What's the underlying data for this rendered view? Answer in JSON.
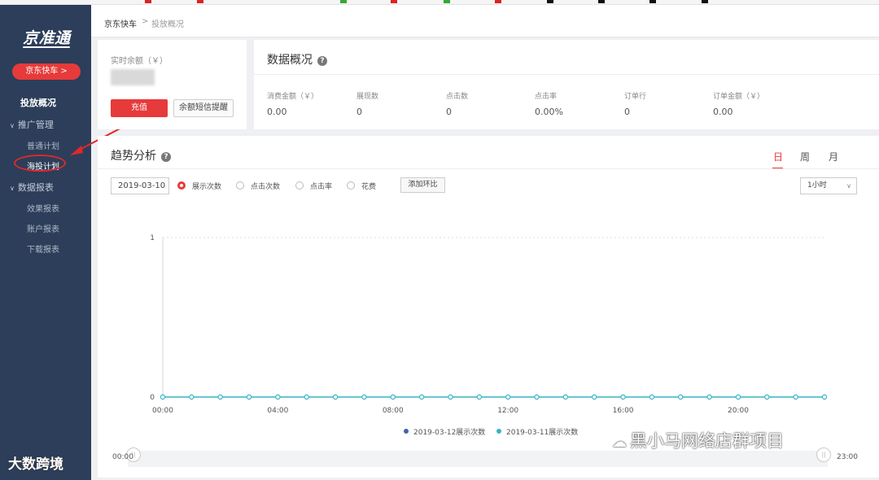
{
  "sidebar": {
    "logo": "京准通",
    "product_button": "京东快车 >",
    "nav": {
      "overview": "投放概况",
      "promo_group": "推广管理",
      "normal_plan": "普通计划",
      "mass_plan": "海投计划",
      "report_group": "数据报表",
      "effect_report": "效果报表",
      "account_report": "账户报表",
      "download_report": "下载报表"
    }
  },
  "breadcrumb": {
    "root": "京东快车",
    "sep": ">",
    "current": "投放概况"
  },
  "balance": {
    "label": "实时余额（￥）",
    "recharge_button": "充值",
    "sms_button": "余额短信提醒"
  },
  "overview": {
    "title": "数据概况",
    "metrics": [
      {
        "label": "消费金额（￥）",
        "value": "0.00"
      },
      {
        "label": "展现数",
        "value": "0"
      },
      {
        "label": "点击数",
        "value": "0"
      },
      {
        "label": "点击率",
        "value": "0.00%"
      },
      {
        "label": "订单行",
        "value": "0"
      },
      {
        "label": "订单金额（￥）",
        "value": "0.00"
      }
    ]
  },
  "trend": {
    "title": "趋势分析",
    "periods": [
      "日",
      "周",
      "月"
    ],
    "active_period": "日",
    "date": "2019-03-10",
    "metrics": [
      "展示次数",
      "点击次数",
      "点击率",
      "花费"
    ],
    "selected_metric": "展示次数",
    "compare_button": "添加环比",
    "interval": "1小时",
    "slider": {
      "start": "00:00",
      "end": "23:00"
    }
  },
  "chart_data": {
    "type": "line",
    "x": [
      "00:00",
      "01:00",
      "02:00",
      "03:00",
      "04:00",
      "05:00",
      "06:00",
      "07:00",
      "08:00",
      "09:00",
      "10:00",
      "11:00",
      "12:00",
      "13:00",
      "14:00",
      "15:00",
      "16:00",
      "17:00",
      "18:00",
      "19:00",
      "20:00",
      "21:00",
      "22:00",
      "23:00"
    ],
    "x_tick_labels": [
      "00:00",
      "04:00",
      "08:00",
      "12:00",
      "16:00",
      "20:00"
    ],
    "y_tick_labels": [
      "0",
      "1"
    ],
    "ylim": [
      0,
      1
    ],
    "series": [
      {
        "name": "2019-03-12展示次数",
        "color": "#3f64a8",
        "values": []
      },
      {
        "name": "2019-03-11展示次数",
        "color": "#38b3c4",
        "values": [
          0,
          0,
          0,
          0,
          0,
          0,
          0,
          0,
          0,
          0,
          0,
          0,
          0,
          0,
          0,
          0,
          0,
          0,
          0,
          0,
          0,
          0,
          0,
          0
        ]
      }
    ],
    "legend": "bottom"
  },
  "watermarks": {
    "left": "大数跨境",
    "right": "黑小马网络店群项目"
  },
  "colors": {
    "sidebar": "#2c3e5a",
    "accent": "#e73a3a",
    "line": "#38b3c4"
  }
}
